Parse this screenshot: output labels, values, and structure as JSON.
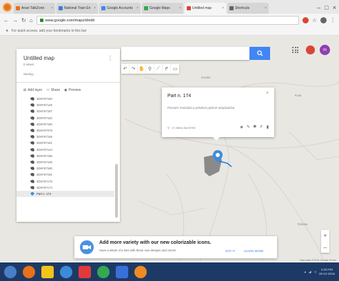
{
  "browser": {
    "tabs": [
      {
        "label": "Anari TalkZone",
        "color": "#e8711a"
      },
      {
        "label": "National Train En",
        "color": "#3b7dd8"
      },
      {
        "label": "Google Accounts",
        "color": "#4285f4"
      },
      {
        "label": "Google Maps",
        "color": "#34a853"
      },
      {
        "label": "Untitled map",
        "color": "#db4437",
        "active": true
      },
      {
        "label": "Shortcuts",
        "color": "#5f6368"
      }
    ],
    "url": "www.google.com/maps/d/edit",
    "bookmarks_hint": "For quick access, add your bookmarks to this bar"
  },
  "sidebar": {
    "map_title": "Untitled map",
    "views": "0 views",
    "saving": "Saving...",
    "actions": {
      "add_layer": "Add layer",
      "share": "Share",
      "preview": "Preview"
    },
    "items": [
      "3DKF87182",
      "3DKF87125",
      "3DKF87187",
      "3DKF87182",
      "3DKF87180",
      "3DKF87078",
      "3DKF87155",
      "3DKF87181",
      "3DKF87144",
      "3DKF87185",
      "3DKF87106",
      "3DKF87180",
      "3DKF87191",
      "3DKF87175",
      "3DKF87174",
      "Part n. 174"
    ]
  },
  "search": {
    "placeholder": ""
  },
  "avatar_letter": "m",
  "card": {
    "title": "Part n. 174",
    "description": "Ρλοοαλτ πτολοάλα ρ ραλαλοσ ρρλλοπ ααλρλααλλα",
    "coords": "17.26814,36.00700"
  },
  "map_labels": {
    "north": "Kunda",
    "east": "Kota",
    "south": "Rahata"
  },
  "banner": {
    "title": "Add more variety with our new colorizable icons.",
    "subtitle": "Have a whale of a time with these new designs and colors!",
    "got_it": "GOT IT",
    "learn_more": "LEARN MORE"
  },
  "attribution": "Map data ©2016 Google    Terms",
  "taskbar": {
    "time": "5:20 PM",
    "date": "26-12-2016"
  },
  "colors": {
    "accent": "#4285f4",
    "polygon": "#8a8a8a",
    "taskbar": "#1d3a66"
  }
}
